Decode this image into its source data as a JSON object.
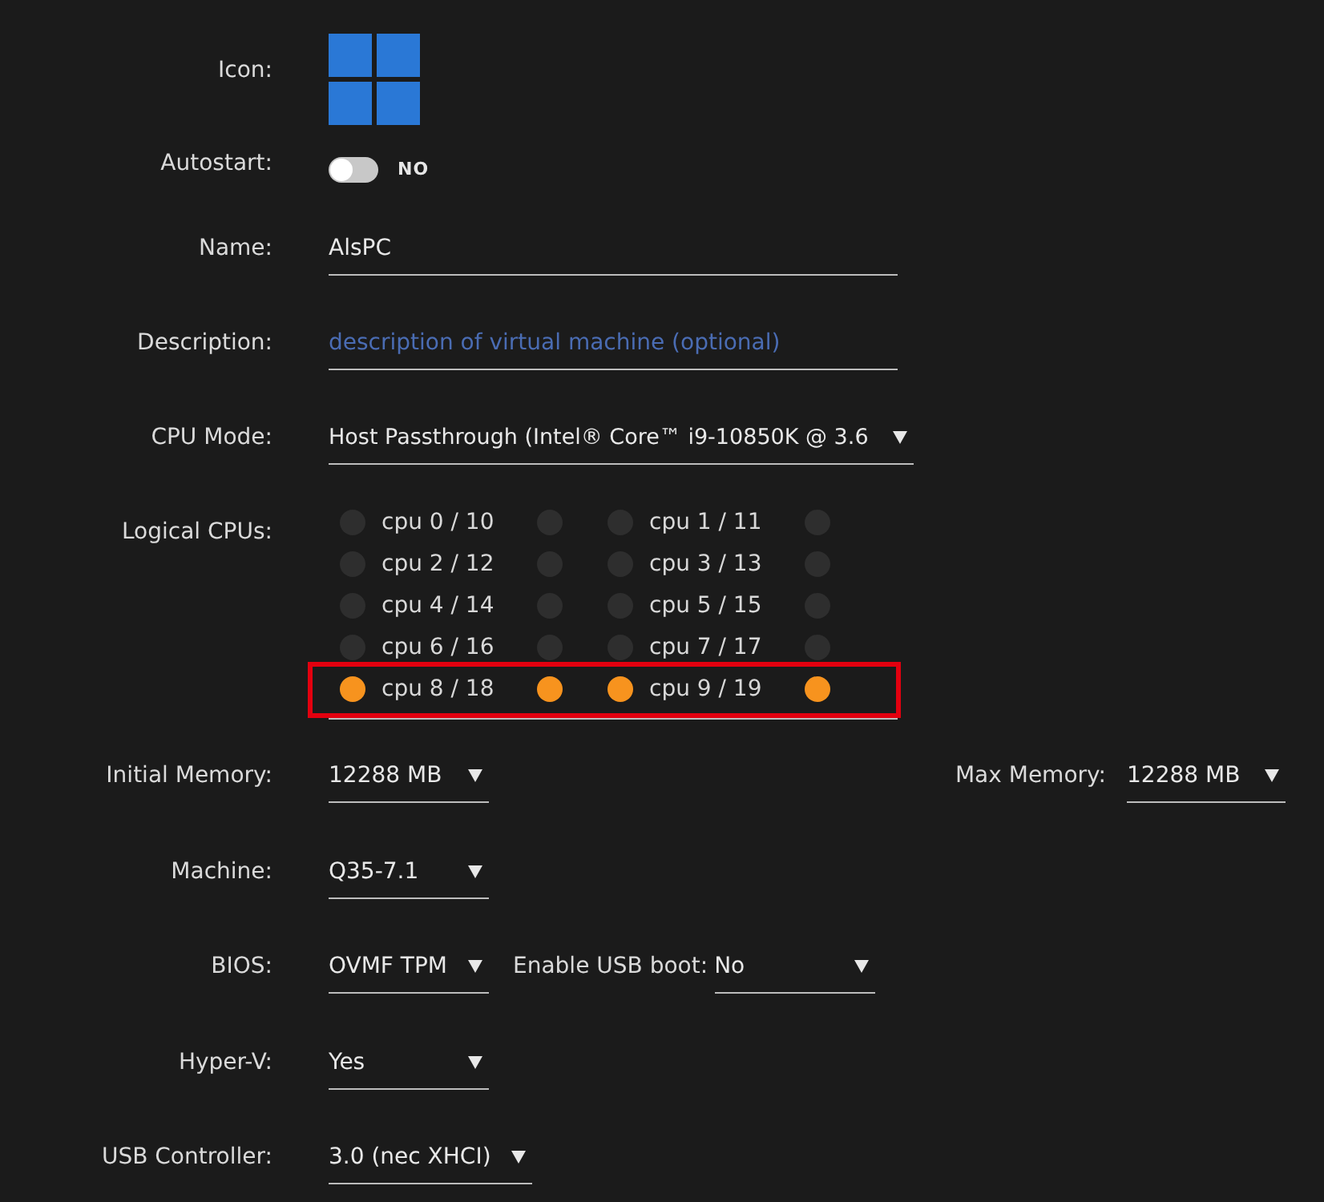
{
  "icon": {
    "label": "Icon:"
  },
  "autostart": {
    "label": "Autostart:",
    "on": false,
    "state_text": "NO"
  },
  "name": {
    "label": "Name:",
    "value": "AlsPC"
  },
  "description": {
    "label": "Description:",
    "placeholder": "description of virtual machine (optional)"
  },
  "cpu_mode": {
    "label": "CPU Mode:",
    "value": "Host Passthrough (Intel® Core™ i9-10850K @ 3.6"
  },
  "logical_cpus": {
    "label": "Logical CPUs:",
    "rows": [
      {
        "highlighted": false,
        "pairs": [
          {
            "label": "cpu 0 / 10",
            "threads": [
              {
                "checked": false
              },
              {
                "checked": false
              }
            ]
          },
          {
            "label": "cpu 1 / 11",
            "threads": [
              {
                "checked": false
              },
              {
                "checked": false
              }
            ]
          }
        ]
      },
      {
        "highlighted": false,
        "pairs": [
          {
            "label": "cpu 2 / 12",
            "threads": [
              {
                "checked": false
              },
              {
                "checked": false
              }
            ]
          },
          {
            "label": "cpu 3 / 13",
            "threads": [
              {
                "checked": false
              },
              {
                "checked": false
              }
            ]
          }
        ]
      },
      {
        "highlighted": false,
        "pairs": [
          {
            "label": "cpu 4 / 14",
            "threads": [
              {
                "checked": false
              },
              {
                "checked": false
              }
            ]
          },
          {
            "label": "cpu 5 / 15",
            "threads": [
              {
                "checked": false
              },
              {
                "checked": false
              }
            ]
          }
        ]
      },
      {
        "highlighted": false,
        "pairs": [
          {
            "label": "cpu 6 / 16",
            "threads": [
              {
                "checked": false
              },
              {
                "checked": false
              }
            ]
          },
          {
            "label": "cpu 7 / 17",
            "threads": [
              {
                "checked": false
              },
              {
                "checked": false
              }
            ]
          }
        ]
      },
      {
        "highlighted": true,
        "pairs": [
          {
            "label": "cpu 8 / 18",
            "threads": [
              {
                "checked": true
              },
              {
                "checked": true
              }
            ]
          },
          {
            "label": "cpu 9 / 19",
            "threads": [
              {
                "checked": true
              },
              {
                "checked": true
              }
            ]
          }
        ]
      }
    ]
  },
  "initial_memory": {
    "label": "Initial Memory:",
    "value": "12288 MB"
  },
  "max_memory": {
    "label": "Max Memory:",
    "value": "12288 MB"
  },
  "machine": {
    "label": "Machine:",
    "value": "Q35-7.1"
  },
  "bios": {
    "label": "BIOS:",
    "value": "OVMF TPM"
  },
  "usb_boot": {
    "label": "Enable USB boot:",
    "value": "No"
  },
  "hyper_v": {
    "label": "Hyper-V:",
    "value": "Yes"
  },
  "usb_controller": {
    "label": "USB Controller:",
    "value": "3.0 (nec XHCI)"
  }
}
